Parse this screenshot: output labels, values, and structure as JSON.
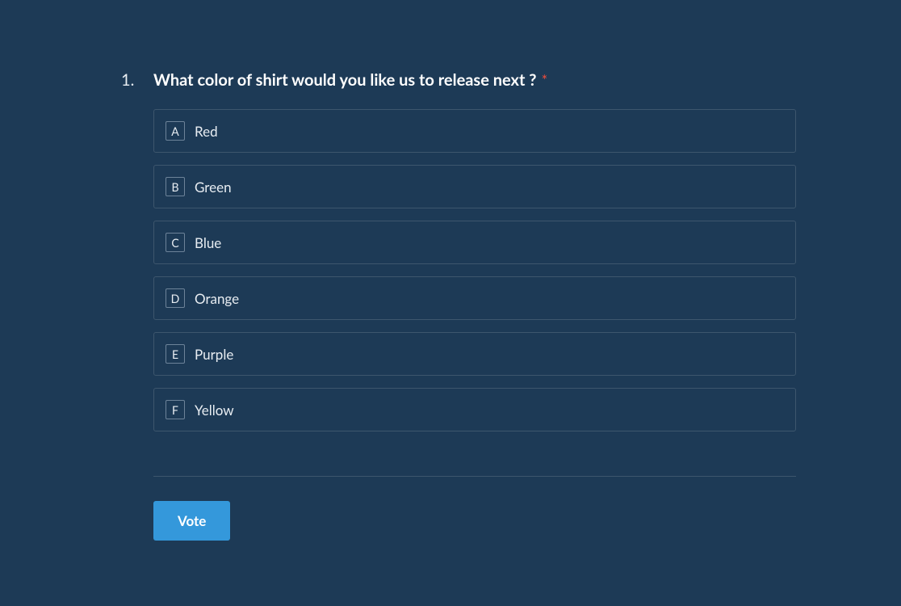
{
  "question": {
    "number": "1.",
    "text": "What color of shirt would you like us to release next ?",
    "required": true,
    "options": [
      {
        "key": "A",
        "label": "Red"
      },
      {
        "key": "B",
        "label": "Green"
      },
      {
        "key": "C",
        "label": "Blue"
      },
      {
        "key": "D",
        "label": "Orange"
      },
      {
        "key": "E",
        "label": "Purple"
      },
      {
        "key": "F",
        "label": "Yellow"
      }
    ]
  },
  "submit_label": "Vote",
  "required_marker": "*"
}
